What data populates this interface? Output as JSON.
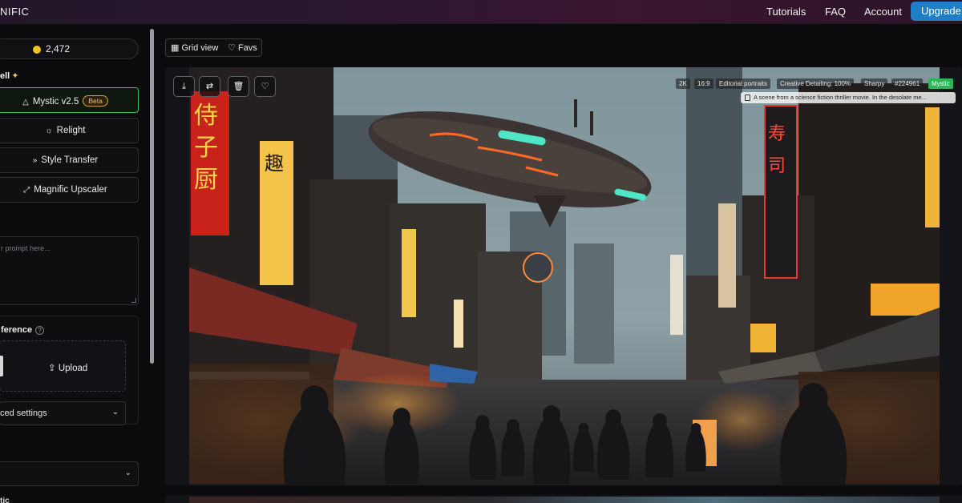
{
  "header": {
    "brand": "NIFIC",
    "links": [
      "Tutorials",
      "FAQ",
      "Account"
    ],
    "upgrade": "Upgrade"
  },
  "sidebar": {
    "credits": "2,472",
    "section_title": "ell",
    "models": [
      {
        "label": "Mystic v2.5",
        "badge": "Beta",
        "icon": "triangle-icon",
        "active": true
      },
      {
        "label": "Relight",
        "icon": "sun-icon"
      },
      {
        "label": "Style Transfer",
        "icon": "double-chevron-icon"
      },
      {
        "label": "Magnific Upscaler",
        "icon": "expand-icon"
      }
    ],
    "prompt_placeholder": "r prompt here...",
    "reference_label": "ference",
    "upload_label": "Upload",
    "advanced_label": "ced settings",
    "bottom_label": "tic"
  },
  "main": {
    "view_toggle": {
      "grid": "Grid view",
      "favs": "Favs"
    },
    "image": {
      "tags": [
        "2K",
        "16:9",
        "Editorial portraits",
        "Creative Detailing: 100%",
        "Sharpy",
        "#224961",
        "Mystic"
      ],
      "prompt_preview": "A scene from a science fiction thriller movie. In the desolate me..."
    }
  },
  "colors": {
    "accent_blue": "#1f7fc6",
    "active_green": "#39c26a",
    "mystic_tag": "#2fb45a",
    "beta_gold": "#d6a23a",
    "coin": "#f0c419"
  }
}
